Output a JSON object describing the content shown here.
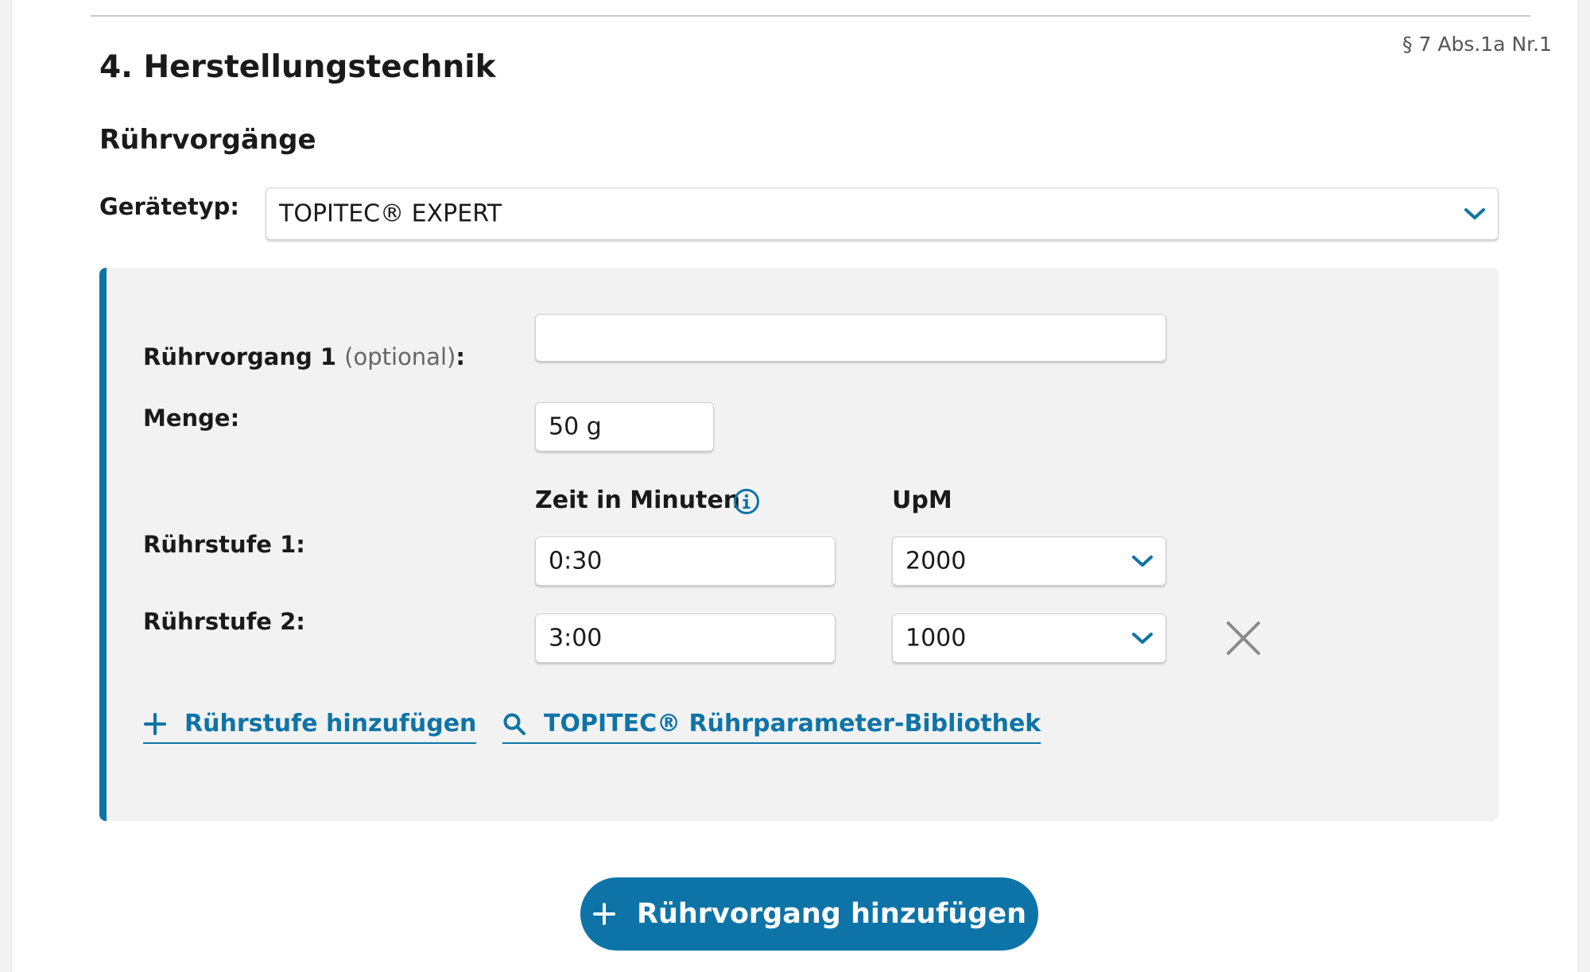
{
  "section": {
    "legal_ref": "§ 7 Abs.1a Nr.1",
    "title": "4. Herstellungstechnik",
    "subtitle": "Rührvorgänge"
  },
  "device": {
    "label": "Gerätetyp:",
    "selected": "TOPITEC® EXPERT",
    "icon": "chevron-down-icon"
  },
  "stir_process": {
    "name_label": "Rührvorgang 1",
    "name_optional": "(optional)",
    "name_colon": ":",
    "name_value": "",
    "amount_label": "Menge:",
    "amount_value": "50 g",
    "col_time": "Zeit in Minuten",
    "col_rpm": "UpM",
    "steps": [
      {
        "label": "Rührstufe 1:",
        "time": "0:30",
        "rpm": "2000"
      },
      {
        "label": "Rührstufe 2:",
        "time": "3:00",
        "rpm": "1000"
      }
    ],
    "add_step_link": "Rührstufe hinzufügen",
    "library_link": "TOPITEC® Rührparameter-Bibliothek"
  },
  "add_process_button": "Rührvorgang hinzufügen",
  "colors": {
    "accent": "#0e74a7",
    "panel_bg": "#f2f2f2"
  }
}
